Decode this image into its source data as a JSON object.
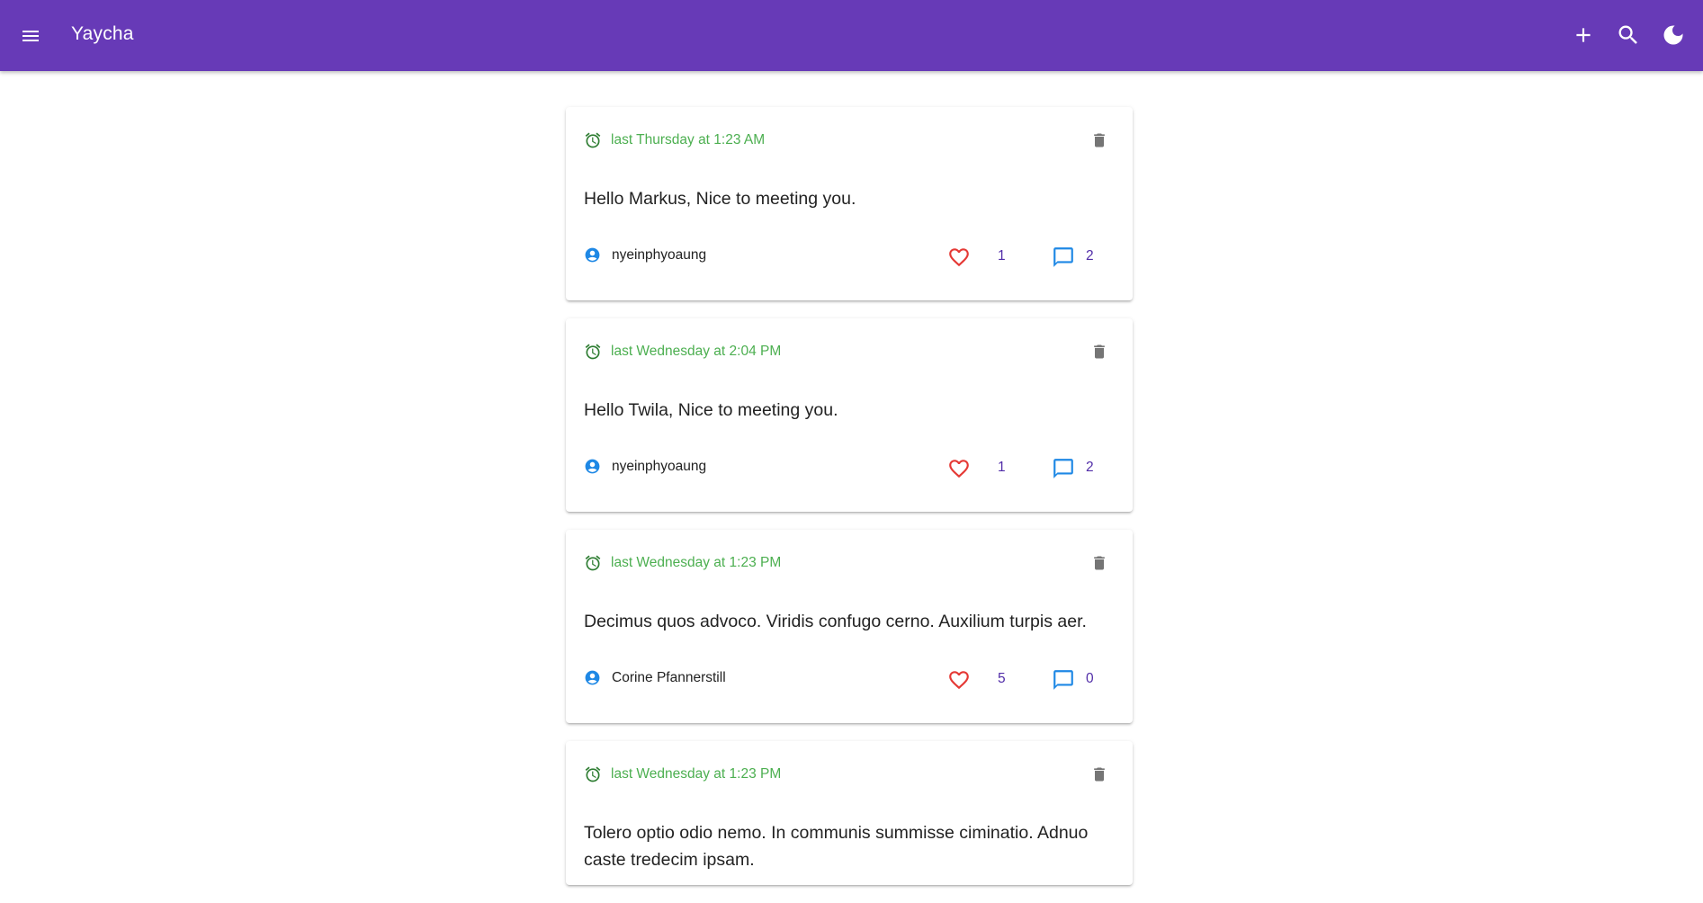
{
  "app": {
    "title": "Yaycha",
    "colors": {
      "primary": "#673ab7",
      "time": "#4caf50",
      "like": "#e53935",
      "comment": "#1e88e5",
      "count": "#512da8"
    },
    "icons": {
      "menu": "menu-icon",
      "add": "plus-icon",
      "search": "search-icon",
      "theme": "moon-icon"
    }
  },
  "posts": [
    {
      "time": "last Thursday at 1:23 AM",
      "content": "Hello Markus, Nice to meeting you.",
      "author": "nyeinphyoaung",
      "likes": "1",
      "comments": "2"
    },
    {
      "time": "last Wednesday at 2:04 PM",
      "content": "Hello Twila, Nice to meeting you.",
      "author": "nyeinphyoaung",
      "likes": "1",
      "comments": "2"
    },
    {
      "time": "last Wednesday at 1:23 PM",
      "content": "Decimus quos advoco. Viridis confugo cerno. Auxilium turpis aer.",
      "author": "Corine Pfannerstill",
      "likes": "5",
      "comments": "0"
    },
    {
      "time": "last Wednesday at 1:23 PM",
      "content": "Tolero optio odio nemo. In communis summisse ciminatio. Adnuo caste tredecim ipsam.",
      "author": "",
      "likes": "",
      "comments": ""
    }
  ]
}
